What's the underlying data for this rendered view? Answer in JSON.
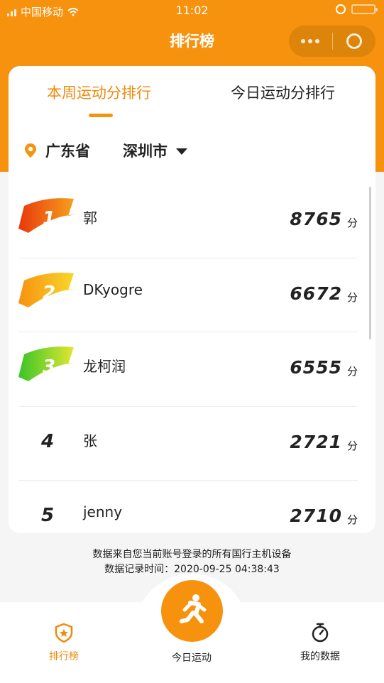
{
  "status_bar": {
    "carrier": "中国移动",
    "time": "11:02"
  },
  "nav": {
    "title": "排行榜"
  },
  "tabs": [
    {
      "label": "本周运动分排行",
      "active": true
    },
    {
      "label": "今日运动分排行",
      "active": false
    }
  ],
  "location": {
    "province": "广东省",
    "city": "深圳市"
  },
  "ranking": [
    {
      "rank": "1",
      "name": "郭",
      "score": "8765",
      "unit": "分",
      "badge_colors": [
        "#e8380d",
        "#f7a21b"
      ]
    },
    {
      "rank": "2",
      "name": "DKyogre",
      "score": "6672",
      "unit": "分",
      "badge_colors": [
        "#f7920f",
        "#f9d72b"
      ]
    },
    {
      "rank": "3",
      "name": "龙柯润",
      "score": "6555",
      "unit": "分",
      "badge_colors": [
        "#39c428",
        "#e6e830"
      ]
    },
    {
      "rank": "4",
      "name": "张",
      "score": "2721",
      "unit": "分"
    },
    {
      "rank": "5",
      "name": "jenny",
      "score": "2710",
      "unit": "分"
    }
  ],
  "footer": {
    "note": "数据来自您当前账号登录的所有国行主机设备",
    "record_time": "数据记录时间：2020-09-25 04:38:43"
  },
  "tab_bar": {
    "rank_label": "排行榜",
    "today_label": "今日运动",
    "mine_label": "我的数据"
  },
  "colors": {
    "accent": "#f7920f",
    "accent_text": "#f08a0c"
  }
}
